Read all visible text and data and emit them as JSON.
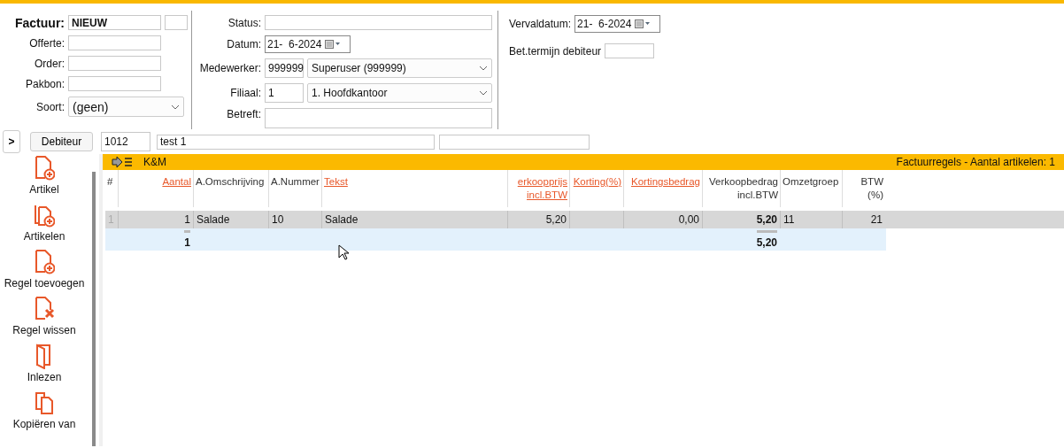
{
  "form": {
    "invoice": {
      "label": "Factuur:",
      "value": "NIEUW"
    },
    "left_fields": [
      {
        "label": "Offerte:"
      },
      {
        "label": "Order:"
      },
      {
        "label": "Pakbon:"
      }
    ],
    "soort": {
      "label": "Soort:",
      "value": "(geen)"
    },
    "status": {
      "label": "Status:"
    },
    "datum": {
      "label": "Datum:",
      "value": "21-  6-2024"
    },
    "medewerker": {
      "label": "Medewerker:",
      "code": "999999",
      "value": "Superuser (999999)"
    },
    "filiaal": {
      "label": "Filiaal:",
      "code": "1",
      "value": "1. Hoofdkantoor"
    },
    "betreft": {
      "label": "Betreft:"
    },
    "vervaldatum": {
      "label": "Vervaldatum:",
      "value": "21-  6-2024"
    },
    "bet_termijn": {
      "label": "Bet.termijn debiteur"
    }
  },
  "debtor_bar": {
    "toggle": ">",
    "button": "Debiteur",
    "code": "1012",
    "name": "test 1"
  },
  "sidebar": {
    "actions": [
      {
        "label": "Artikel",
        "kind": "add"
      },
      {
        "label": "Artikelen",
        "kind": "add-multiple"
      },
      {
        "label": "Regel toevoegen",
        "kind": "add"
      },
      {
        "label": "Regel wissen",
        "kind": "delete"
      },
      {
        "label": "Inlezen",
        "kind": "import"
      },
      {
        "label": "Kopiëren van",
        "kind": "copy"
      }
    ]
  },
  "grid": {
    "title": "K&M",
    "summary": "Factuurregels - Aantal artikelen: 1",
    "columns": [
      {
        "label": "#",
        "sortable": false
      },
      {
        "label": "Aantal",
        "sortable": true
      },
      {
        "label": "A.Omschrijving",
        "sortable": false
      },
      {
        "label": "A.Nummer",
        "sortable": false
      },
      {
        "label": "Tekst",
        "sortable": true
      },
      {
        "label": "erkoopprijs incl.BTW",
        "sortable": true
      },
      {
        "label": "Korting(%)",
        "sortable": true
      },
      {
        "label": "Kortingsbedrag",
        "sortable": true
      },
      {
        "label": "Verkoopbedrag incl.BTW",
        "sortable": false
      },
      {
        "label": "Omzetgroep",
        "sortable": false
      },
      {
        "label": "BTW (%)",
        "sortable": false
      }
    ],
    "rows": [
      {
        "selected": true,
        "cells": [
          "1",
          "1",
          "Salade",
          "10",
          "Salade",
          "5,20",
          null,
          "0,00",
          "5,20",
          "11",
          "21"
        ]
      }
    ],
    "totals": {
      "aantal": "1",
      "verkoopbedrag": "5,20"
    }
  }
}
